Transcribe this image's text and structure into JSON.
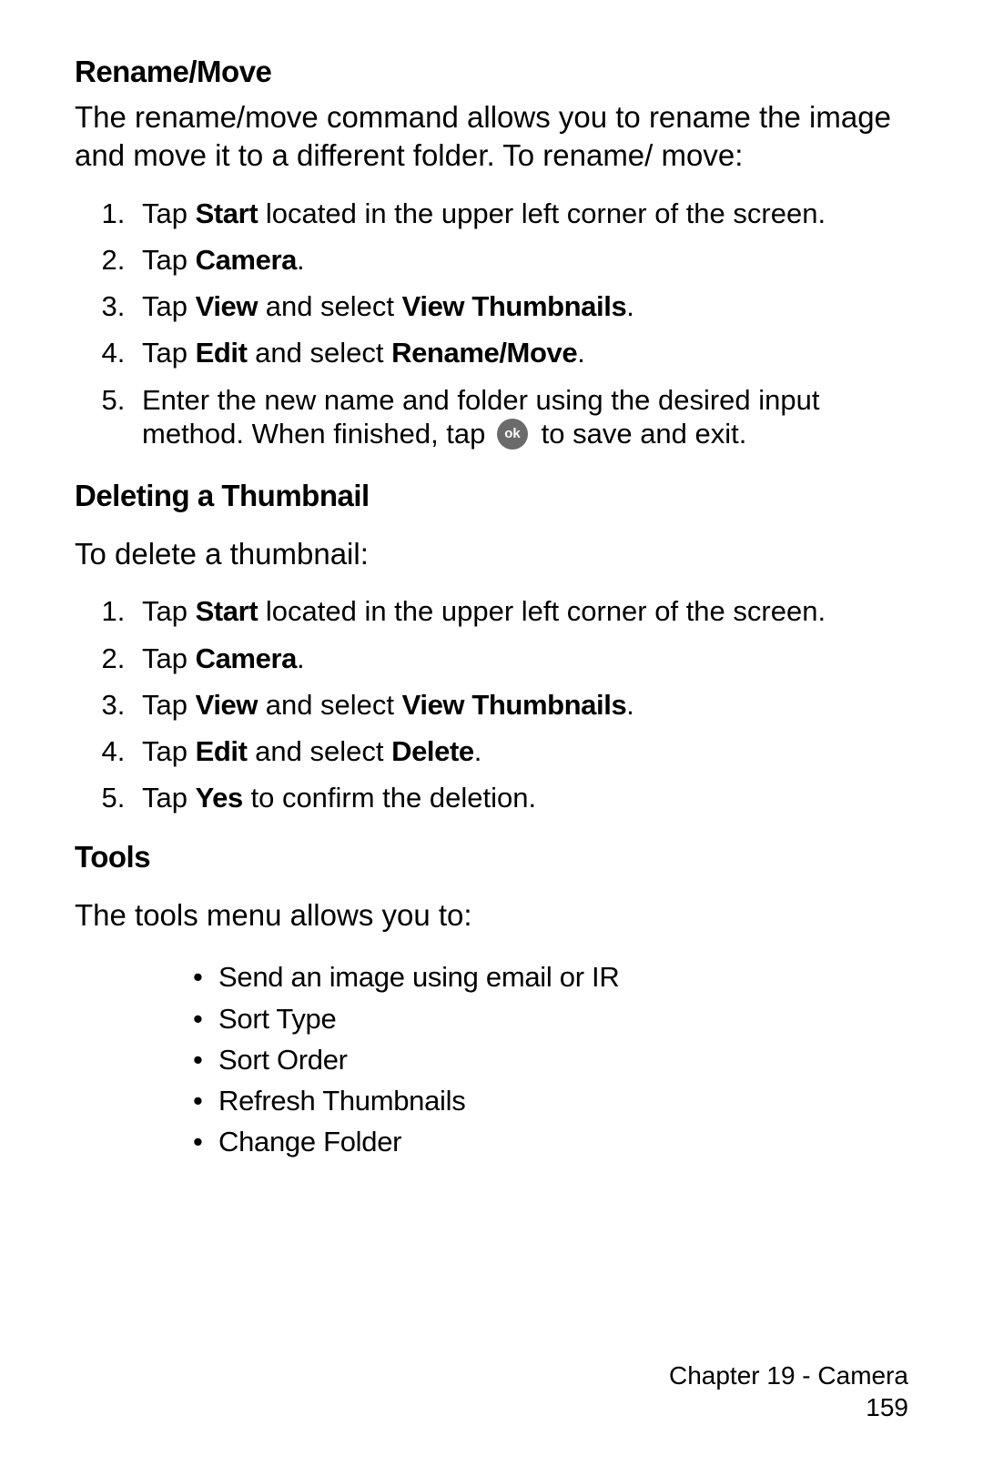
{
  "section1": {
    "heading": "Rename/Move",
    "intro": "The rename/move command allows you to rename the image and move it to a different folder. To rename/ move:",
    "steps": {
      "s1_pre": "Tap ",
      "s1_b1": "Start",
      "s1_post": " located in the upper left corner of the screen.",
      "s2_pre": "Tap ",
      "s2_b1": "Camera",
      "s2_post": ".",
      "s3_pre": "Tap ",
      "s3_b1": "View",
      "s3_mid": " and select ",
      "s3_b2": "View Thumbnails",
      "s3_post": ".",
      "s4_pre": "Tap ",
      "s4_b1": "Edit",
      "s4_mid": " and select ",
      "s4_b2": "Rename/Move",
      "s4_post": ".",
      "s5_pre": "Enter the new name and folder using the desired input method. When finished, tap ",
      "s5_icon_label": "ok",
      "s5_post": " to save and exit."
    }
  },
  "section2": {
    "heading": "Deleting a Thumbnail",
    "intro": "To delete a thumbnail:",
    "steps": {
      "s1_pre": "Tap ",
      "s1_b1": "Start",
      "s1_post": " located in the upper left corner of the screen.",
      "s2_pre": "Tap ",
      "s2_b1": "Camera",
      "s2_post": ".",
      "s3_pre": "Tap ",
      "s3_b1": "View",
      "s3_mid": " and select ",
      "s3_b2": "View Thumbnails",
      "s3_post": ".",
      "s4_pre": "Tap ",
      "s4_b1": "Edit",
      "s4_mid": " and select ",
      "s4_b2": "Delete",
      "s4_post": ".",
      "s5_pre": "Tap ",
      "s5_b1": "Yes",
      "s5_post": " to confirm the deletion."
    }
  },
  "section3": {
    "heading": "Tools",
    "intro": "The tools menu allows you to:",
    "bullets": {
      "b1": "Send an image using email or IR",
      "b2": "Sort Type",
      "b3": "Sort Order",
      "b4": "Refresh Thumbnails",
      "b5": "Change Folder"
    }
  },
  "footer": {
    "chapter": "Chapter 19 - Camera",
    "page": "159"
  }
}
